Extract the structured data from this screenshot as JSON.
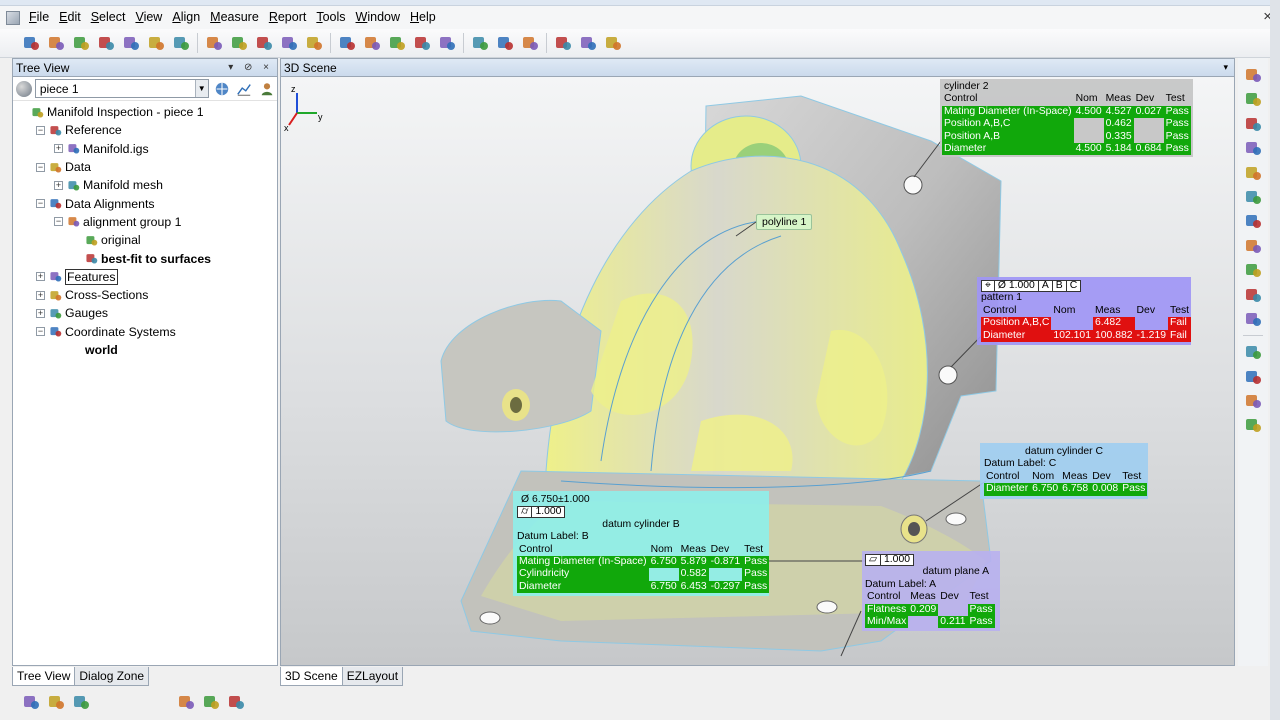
{
  "menu": [
    "File",
    "Edit",
    "Select",
    "View",
    "Align",
    "Measure",
    "Report",
    "Tools",
    "Window",
    "Help"
  ],
  "menu_hotkey_index": [
    0,
    0,
    0,
    0,
    0,
    0,
    0,
    0,
    0,
    0
  ],
  "toolbar_icons": [
    "new-file-icon",
    "open-folder-icon",
    "save-icon",
    "undo-icon",
    "settings-icon",
    "redo-icon",
    "properties-icon",
    "sep",
    "edit-icon",
    "brush-icon",
    "binary-icon",
    "color-map-icon",
    "axis-icon",
    "sep",
    "cube-icon",
    "probe-icon",
    "surfaces-icon",
    "cut-icon",
    "nodes-icon",
    "sep",
    "ruler-icon",
    "gauge-icon",
    "tripod-icon",
    "sep",
    "grid-icon",
    "camera-icon",
    "layout-icon"
  ],
  "tree_panel": {
    "title": "Tree View",
    "header_buttons": "▾ ⊘ ×",
    "piece_value": "piece 1"
  },
  "tree": [
    {
      "label": "Manifold Inspection - piece 1",
      "level": 0,
      "expander": "",
      "icon": "inspection-icon",
      "style": ""
    },
    {
      "label": "Reference",
      "level": 1,
      "expander": "−",
      "icon": "reference-icon",
      "style": ""
    },
    {
      "label": "Manifold.igs",
      "level": 2,
      "expander": "+",
      "icon": "cad-file-icon",
      "style": ""
    },
    {
      "label": "Data",
      "level": 1,
      "expander": "−",
      "icon": "data-icon",
      "style": ""
    },
    {
      "label": "Manifold mesh",
      "level": 2,
      "expander": "+",
      "icon": "mesh-icon",
      "style": ""
    },
    {
      "label": "Data Alignments",
      "level": 1,
      "expander": "−",
      "icon": "alignment-icon",
      "style": ""
    },
    {
      "label": "alignment group 1",
      "level": 2,
      "expander": "−",
      "icon": "alignment-group-icon",
      "style": ""
    },
    {
      "label": "original",
      "level": 3,
      "expander": "",
      "icon": "original-alignment-icon",
      "style": ""
    },
    {
      "label": "best-fit to surfaces",
      "level": 3,
      "expander": "",
      "icon": "best-fit-icon",
      "style": "bold"
    },
    {
      "label": "Features",
      "level": 1,
      "expander": "+",
      "icon": "features-icon",
      "style": "boxed"
    },
    {
      "label": "Cross-Sections",
      "level": 1,
      "expander": "+",
      "icon": "cross-section-icon",
      "style": ""
    },
    {
      "label": "Gauges",
      "level": 1,
      "expander": "+",
      "icon": "gauge-icon",
      "style": ""
    },
    {
      "label": "Coordinate Systems",
      "level": 1,
      "expander": "−",
      "icon": "coordinate-icon",
      "style": ""
    },
    {
      "label": "world",
      "level": 3,
      "expander": "",
      "icon": "",
      "style": "bold"
    }
  ],
  "left_tabs": [
    "Tree View",
    "Dialog Zone"
  ],
  "left_bottom_icons": [
    "filter-icon",
    "document-icon",
    "table-icon",
    "sep",
    "group-icon",
    "refresh-icon",
    "pointer-icon"
  ],
  "scene": {
    "title": "3D Scene",
    "pin": "▾",
    "tabs": [
      "3D Scene",
      "EZLayout"
    ],
    "axis_labels": {
      "x": "x",
      "y": "y",
      "z": "z"
    },
    "polyline_label": "polyline 1"
  },
  "callouts": {
    "cylinder2": {
      "title": "cylinder 2",
      "header": [
        "Control",
        "Nom",
        "Meas",
        "Dev",
        "Test"
      ],
      "rows": [
        [
          "Mating Diameter (In-Space)",
          "4.500",
          "4.527",
          "0.027",
          "Pass"
        ],
        [
          "Position A,B,C",
          "",
          "0.462",
          "",
          "Pass"
        ],
        [
          "Position A,B",
          "",
          "0.335",
          "",
          "Pass"
        ],
        [
          "Diameter",
          "4.500",
          "5.184",
          "0.684",
          "Pass"
        ]
      ]
    },
    "pattern1": {
      "fcf": [
        "⌖",
        "Ø  1.000",
        "A",
        "B",
        "C"
      ],
      "title": "pattern 1",
      "header": [
        "Control",
        "Nom",
        "Meas",
        "Dev",
        "Test"
      ],
      "rows": [
        [
          "Position A,B,C",
          "",
          "6.482",
          "",
          "Fail"
        ],
        [
          "Diameter",
          "102.101",
          "100.882",
          "-1.219",
          "Fail"
        ]
      ]
    },
    "datumC": {
      "title": "datum cylinder C",
      "datum_label": "Datum Label:  C",
      "header": [
        "Control",
        "Nom",
        "Meas",
        "Dev",
        "Test"
      ],
      "rows": [
        [
          "Diameter",
          "6.750",
          "6.758",
          "0.008",
          "Pass"
        ]
      ]
    },
    "datumB": {
      "dim": "Ø  6.750±1.000",
      "fcf": [
        "⌭",
        "1.000"
      ],
      "title": "datum cylinder B",
      "datum_label": "Datum Label:  B",
      "header": [
        "Control",
        "Nom",
        "Meas",
        "Dev",
        "Test"
      ],
      "rows": [
        [
          "Mating Diameter (In-Space)",
          "6.750",
          "5.879",
          "-0.871",
          "Pass"
        ],
        [
          "Cylindricity",
          "",
          "0.582",
          "",
          "Pass"
        ],
        [
          "Diameter",
          "6.750",
          "6.453",
          "-0.297",
          "Pass"
        ]
      ]
    },
    "datumA": {
      "fcf": [
        "⏥",
        "1.000"
      ],
      "title": "datum plane A",
      "datum_label": "Datum Label:  A",
      "header": [
        "Control",
        "Meas",
        "Dev",
        "Test"
      ],
      "rows": [
        [
          "Flatness",
          "0.209",
          "",
          "Pass"
        ],
        [
          "Min/Max",
          "",
          "0.211",
          "Pass"
        ]
      ]
    }
  },
  "right_toolbar_icons": [
    "select-icon",
    "pointer-icon",
    "floor-icon",
    "zoom-in-icon",
    "zoom-fit-icon",
    "view-icon",
    "cube-view-icon",
    "monitor-icon",
    "display-active-icon",
    "color-icon",
    "palette-icon",
    "sep",
    "probe-icon",
    "bucket-icon",
    "flag-icon",
    "annotate-icon"
  ],
  "colors": {
    "pass": "#11a80b",
    "fail": "#e01010",
    "deviation_yellow": "#eef08a",
    "surface_gray": "#b9b9b9"
  }
}
